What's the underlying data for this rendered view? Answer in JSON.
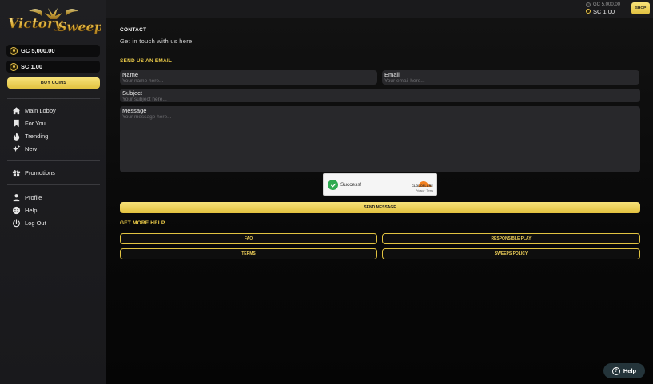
{
  "brand": {
    "logo_text_1": "Victory",
    "logo_text_2": "Sweep"
  },
  "sidebar": {
    "balances": [
      {
        "label": "GC 5,000.00"
      },
      {
        "label": "SC 1.00"
      }
    ],
    "buy_label": "BUY COINS",
    "nav_main": [
      {
        "label": "Main Lobby",
        "icon": "home-icon"
      },
      {
        "label": "For You",
        "icon": "bookmark-icon"
      },
      {
        "label": "Trending",
        "icon": "flame-icon"
      },
      {
        "label": "New",
        "icon": "sparkle-icon"
      }
    ],
    "nav_promos": [
      {
        "label": "Promotions",
        "icon": "gift-icon"
      }
    ],
    "nav_account": [
      {
        "label": "Profile",
        "icon": "user-icon"
      },
      {
        "label": "Help",
        "icon": "smiley-icon"
      },
      {
        "label": "Log Out",
        "icon": "power-icon"
      }
    ]
  },
  "topbar": {
    "gc_label": "GC 5,000.00",
    "sc_label": "SC 1.00",
    "shop_label": "SHOP"
  },
  "contact": {
    "title": "CONTACT",
    "subtitle": "Get in touch with us here.",
    "email_section_title": "SEND US AN EMAIL",
    "name_label": "Name",
    "name_placeholder": "Your name here...",
    "email_label": "Email",
    "email_placeholder": "Your email here...",
    "subject_label": "Subject",
    "subject_placeholder": "Your subject here...",
    "message_label": "Message",
    "message_placeholder": "Your message here...",
    "captcha_status": "Success!",
    "captcha_brand": "CLOUDFLARE",
    "captcha_links": "Privacy · Terms",
    "send_label": "SEND MESSAGE",
    "more_help_title": "GET MORE HELP",
    "links": {
      "faq": "FAQ",
      "responsible": "RESPONSIBLE PLAY",
      "terms": "TERMS",
      "sweeps": "SWEEPS POLICY"
    }
  },
  "float_help_label": "Help",
  "colors": {
    "accent_gold": "#f0cf4a",
    "sidebar_bg": "#1f1f22",
    "success_green": "#2eaa50",
    "cloudflare_orange": "#f38020"
  }
}
